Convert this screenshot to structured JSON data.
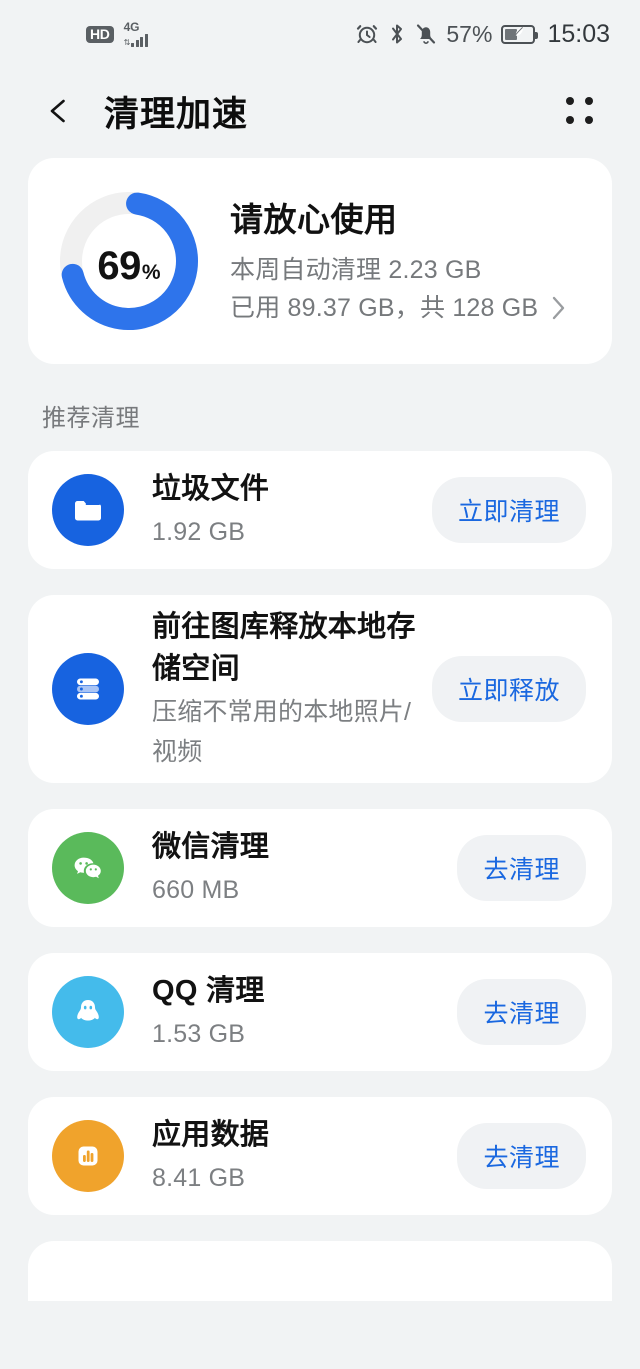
{
  "status_bar": {
    "hd_label": "HD",
    "network_label": "4G",
    "alarm_icon": "alarm-icon",
    "bluetooth_icon": "bluetooth-icon",
    "mute_icon": "bell-muted-icon",
    "battery_percent": "57%",
    "battery_icon": "battery-saver-icon",
    "time": "15:03"
  },
  "header": {
    "back_icon": "back-arrow-icon",
    "title": "清理加速",
    "menu_icon": "four-dots-menu-icon"
  },
  "summary": {
    "percent_value": "69",
    "percent_symbol": "%",
    "title": "请放心使用",
    "line1": "本周自动清理 2.23 GB",
    "line2": "已用 89.37 GB，共 128 GB",
    "chevron_icon": "chevron-right-icon",
    "ring_color": "#2e74eb",
    "ring_track_color": "#f0f0f0",
    "ring_progress": 69
  },
  "section": {
    "label": "推荐清理"
  },
  "items": [
    {
      "icon_name": "folder-icon",
      "icon_color": "#1763e0",
      "title": "垃圾文件",
      "subtitle": "1.92 GB",
      "button": "立即清理"
    },
    {
      "icon_name": "storage-stack-icon",
      "icon_color": "#1763e0",
      "title": "前往图库释放本地存储空间",
      "subtitle": "压缩不常用的本地照片/视频",
      "button": "立即释放"
    },
    {
      "icon_name": "wechat-icon",
      "icon_color": "#5aba5b",
      "title": "微信清理",
      "subtitle": "660 MB",
      "button": "去清理"
    },
    {
      "icon_name": "qq-penguin-icon",
      "icon_color": "#44bbeb",
      "title": "QQ 清理",
      "subtitle": "1.53 GB",
      "button": "去清理"
    },
    {
      "icon_name": "app-data-chart-icon",
      "icon_color": "#f0a32c",
      "title": "应用数据",
      "subtitle": "8.41 GB",
      "button": "去清理"
    }
  ],
  "theme": {
    "page_background": "#f1f3f4",
    "card_background": "#ffffff",
    "accent_blue": "#1a68e0",
    "button_background": "#f0f2f4"
  }
}
